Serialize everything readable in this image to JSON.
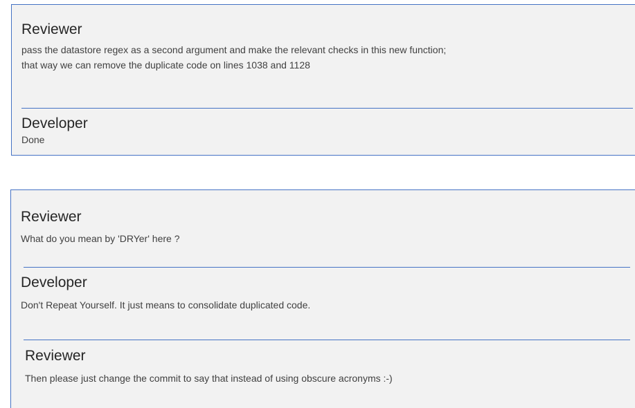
{
  "thread1": {
    "entries": [
      {
        "role": "Reviewer",
        "lines": [
          "pass the datastore regex as a second argument and make the relevant checks in this new function;",
          "that way we can remove the duplicate code on lines 1038 and 1128"
        ]
      },
      {
        "role": "Developer",
        "lines": [
          "Done"
        ]
      }
    ]
  },
  "thread2": {
    "entries": [
      {
        "role": "Reviewer",
        "lines": [
          "What do you mean by 'DRYer' here ?"
        ]
      },
      {
        "role": "Developer",
        "lines": [
          "Don't Repeat Yourself. It just means to consolidate duplicated code."
        ]
      },
      {
        "role": "Reviewer",
        "lines": [
          "Then please just change the commit to say that instead of using obscure acronyms :-)"
        ]
      }
    ]
  },
  "colors": {
    "card_background": "#f2f2f2",
    "accent_border": "#4472c4",
    "text": "#404040"
  }
}
